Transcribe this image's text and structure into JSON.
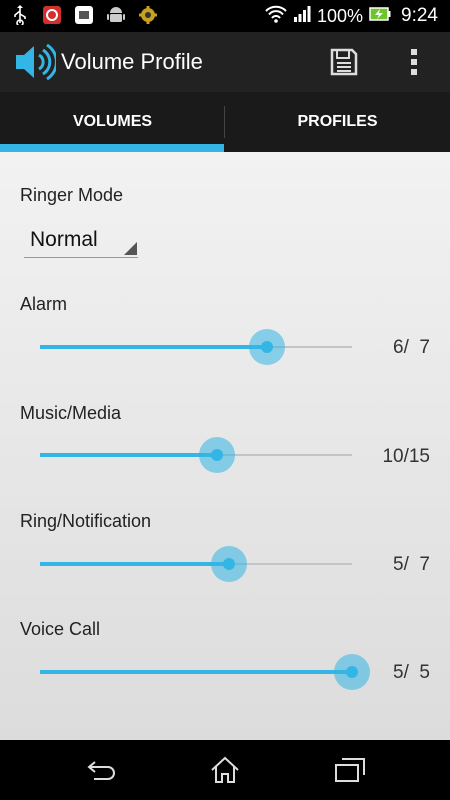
{
  "status_bar": {
    "notification_icons": [
      "usb-icon",
      "security-app-icon",
      "voicemail-app-icon",
      "android-icon",
      "settings-app-icon"
    ],
    "battery_percent": "100%",
    "time": "9:24"
  },
  "action_bar": {
    "title": "Volume Profile",
    "icon": "speaker-volume-icon"
  },
  "tabs": [
    {
      "label": "VOLUMES",
      "selected": true
    },
    {
      "label": "PROFILES",
      "selected": false
    }
  ],
  "ringer_mode": {
    "label": "Ringer Mode",
    "value": "Normal"
  },
  "volumes": {
    "alarm": {
      "label": "Alarm",
      "value_text": "6/  7",
      "level": 6,
      "max": 7
    },
    "music": {
      "label": "Music/Media",
      "value_text": "10/15",
      "level": 10,
      "max": 15
    },
    "ring": {
      "label": "Ring/Notification",
      "value_text": "5/  7",
      "level": 5,
      "max": 7
    },
    "voice": {
      "label": "Voice Call",
      "value_text": "5/  5",
      "level": 5,
      "max": 5
    }
  },
  "colors": {
    "accent": "#33b5e5",
    "action_bar": "#222222",
    "tab_bar": "#1a1a1a"
  }
}
